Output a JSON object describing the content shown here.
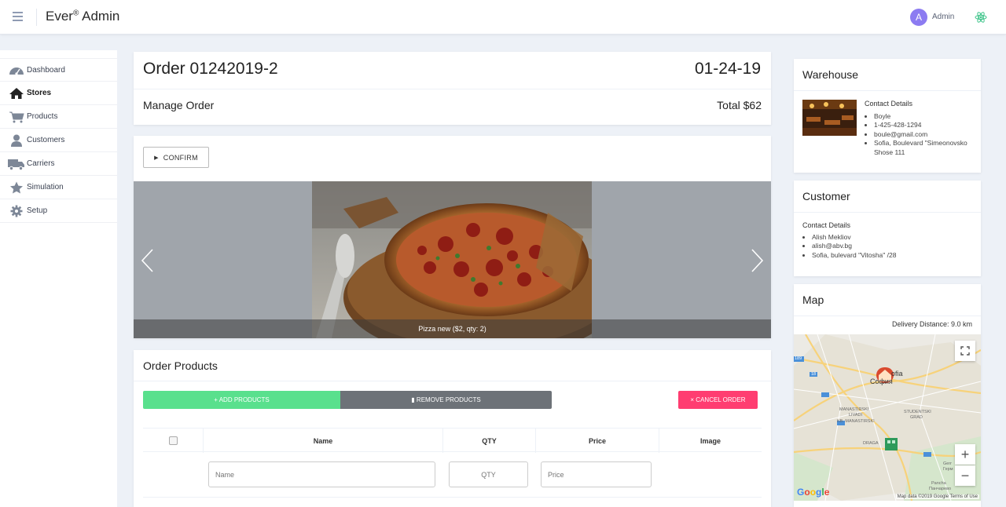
{
  "header": {
    "brand": "Ever",
    "brand_mark": "®",
    "brand_suffix": " Admin",
    "avatar_initial": "A",
    "user_name": "Admin"
  },
  "sidebar": {
    "items": [
      {
        "label": "Dashboard",
        "icon": "dashboard-icon"
      },
      {
        "label": "Stores",
        "icon": "home-icon",
        "active": true
      },
      {
        "label": "Products",
        "icon": "cart-icon"
      },
      {
        "label": "Customers",
        "icon": "user-icon"
      },
      {
        "label": "Carriers",
        "icon": "truck-icon"
      },
      {
        "label": "Simulation",
        "icon": "star-icon"
      },
      {
        "label": "Setup",
        "icon": "gear-icon"
      }
    ]
  },
  "order": {
    "title": "Order 01242019-2",
    "date": "01-24-19",
    "manage_label": "Manage Order",
    "total_label": "Total $62"
  },
  "carousel": {
    "confirm_label": "CONFIRM",
    "caption": "Pizza new ($2, qty: 2)"
  },
  "order_products": {
    "title": "Order Products",
    "add_label": "+ ADD PRODUCTS",
    "remove_label": "REMOVE PRODUCTS",
    "cancel_label": "× CANCEL ORDER",
    "columns": [
      "Name",
      "QTY",
      "Price",
      "Image"
    ],
    "filters": {
      "name": "Name",
      "qty": "QTY",
      "price": "Price"
    }
  },
  "warehouse": {
    "title": "Warehouse",
    "contact_label": "Contact Details",
    "details": [
      "Boyle",
      "1-425-428-1294",
      "boule@gmail.com",
      "Sofia, Boulevard \"Simeonovsko Shose 111"
    ]
  },
  "customer": {
    "title": "Customer",
    "contact_label": "Contact Details",
    "details": [
      "Alish Mekliov",
      "alish@abv.bg",
      "Sofia, bulevard \"Vitosha\" /28"
    ]
  },
  "map": {
    "title": "Map",
    "distance": "Delivery Distance: 9.0 km",
    "google": "Google",
    "credits": "Map data ©2019 Google   Terms of Use",
    "labels": [
      "ofia",
      "София",
      "MANASTIRSKI",
      "LIVADI",
      "KB. MANASTIRSKI",
      "STUDENTSKI",
      "GRAD",
      "Pancha",
      "Панчарево",
      "Gerr",
      "Герм",
      "DRAGA",
      "189",
      "18"
    ]
  },
  "colors": {
    "add": "#59e08d",
    "remove": "#6d7278",
    "cancel": "#ff3d71",
    "avatar": "#8c7bf1",
    "page_bg": "#edf1f7"
  }
}
